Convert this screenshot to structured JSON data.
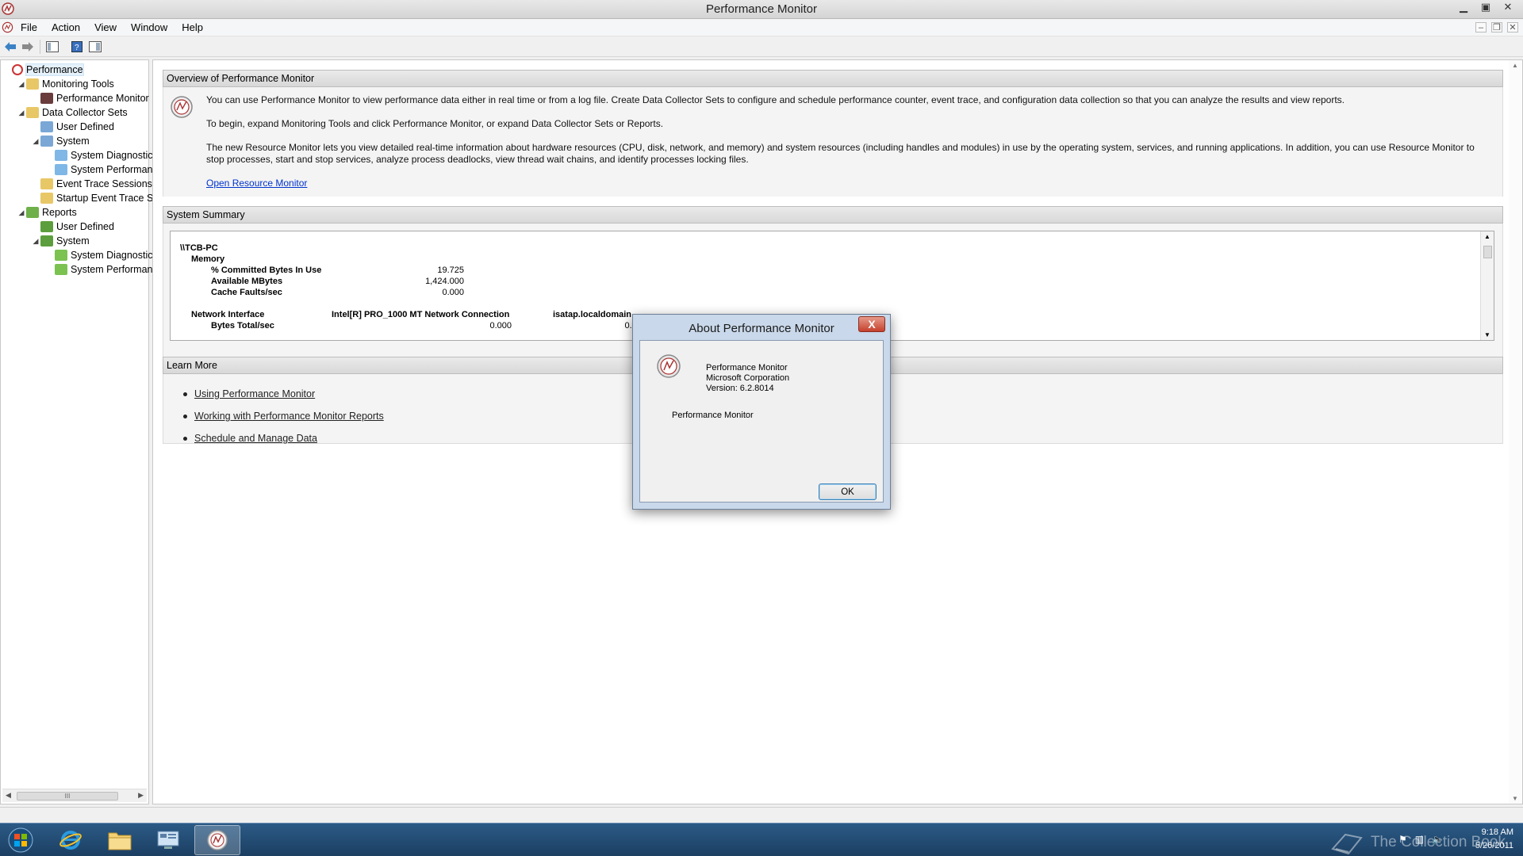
{
  "window": {
    "title": "Performance Monitor"
  },
  "menu": {
    "items": [
      "File",
      "Action",
      "View",
      "Window",
      "Help"
    ]
  },
  "tree": {
    "items": [
      {
        "label": "Performance",
        "level": 0,
        "expander": "",
        "icon": "perf-icon",
        "selected": true
      },
      {
        "label": "Monitoring Tools",
        "level": 1,
        "expander": "◢",
        "icon": "folder-tools-icon"
      },
      {
        "label": "Performance Monitor",
        "level": 2,
        "expander": "",
        "icon": "perf-monitor-icon"
      },
      {
        "label": "Data Collector Sets",
        "level": 1,
        "expander": "◢",
        "icon": "folder-dcs-icon"
      },
      {
        "label": "User Defined",
        "level": 2,
        "expander": "",
        "icon": "user-set-icon"
      },
      {
        "label": "System",
        "level": 2,
        "expander": "◢",
        "icon": "system-set-icon"
      },
      {
        "label": "System Diagnostics",
        "level": 3,
        "expander": "",
        "icon": "diag-set-icon"
      },
      {
        "label": "System Performanc",
        "level": 3,
        "expander": "",
        "icon": "perf-set-icon"
      },
      {
        "label": "Event Trace Sessions",
        "level": 2,
        "expander": "",
        "icon": "trace-icon"
      },
      {
        "label": "Startup Event Trace Ses",
        "level": 2,
        "expander": "",
        "icon": "startup-trace-icon"
      },
      {
        "label": "Reports",
        "level": 1,
        "expander": "◢",
        "icon": "reports-icon"
      },
      {
        "label": "User Defined",
        "level": 2,
        "expander": "",
        "icon": "report-user-icon"
      },
      {
        "label": "System",
        "level": 2,
        "expander": "◢",
        "icon": "report-system-icon"
      },
      {
        "label": "System Diagnostics",
        "level": 3,
        "expander": "",
        "icon": "report-diag-icon"
      },
      {
        "label": "System Performanc",
        "level": 3,
        "expander": "",
        "icon": "report-perf-icon"
      }
    ],
    "scroll_glyph": "III"
  },
  "overview": {
    "header": "Overview of Performance Monitor",
    "p1": "You can use Performance Monitor to view performance data either in real time or from a log file. Create Data Collector Sets to configure and schedule performance counter, event trace, and configuration data collection so that you can analyze the results and view reports.",
    "p2": "To begin, expand Monitoring Tools and click Performance Monitor, or expand Data Collector Sets or Reports.",
    "p3": "The new Resource Monitor lets you view detailed real-time information about hardware resources (CPU, disk, network, and memory) and system resources (including handles and modules) in use by the operating system, services, and running applications. In addition, you can use Resource Monitor to stop processes, start and stop services, analyze process deadlocks, view thread wait chains, and identify processes locking files.",
    "link": "Open Resource Monitor"
  },
  "summary": {
    "header": "System Summary",
    "machine": "\\\\TCB-PC",
    "memory_label": "Memory",
    "counters": [
      {
        "name": "% Committed Bytes In Use",
        "value": "19.725"
      },
      {
        "name": "Available MBytes",
        "value": "1,424.000"
      },
      {
        "name": "Cache Faults/sec",
        "value": "0.000"
      }
    ],
    "network_label": "Network Interface",
    "network_col1": "Intel[R] PRO_1000 MT Network Connection",
    "network_col2": "isatap.localdomain",
    "network_counter": "Bytes Total/sec",
    "network_val1": "0.000",
    "network_val2": "0.000"
  },
  "learn": {
    "header": "Learn More",
    "links": [
      "Using Performance Monitor",
      "Working with Performance Monitor Reports",
      "Schedule and Manage Data"
    ]
  },
  "dialog": {
    "title": "About Performance Monitor",
    "close": "X",
    "product": "Performance Monitor",
    "company": "Microsoft Corporation",
    "version": "Version: 6.2.8014",
    "description": "Performance Monitor",
    "ok": "OK"
  },
  "taskbar": {
    "time": "9:18 AM",
    "date": "5/26/2011",
    "watermark": "The Collection Book"
  },
  "colors": {
    "accent": "#2b5a86",
    "link": "#0033cc",
    "close": "#c5412c"
  }
}
